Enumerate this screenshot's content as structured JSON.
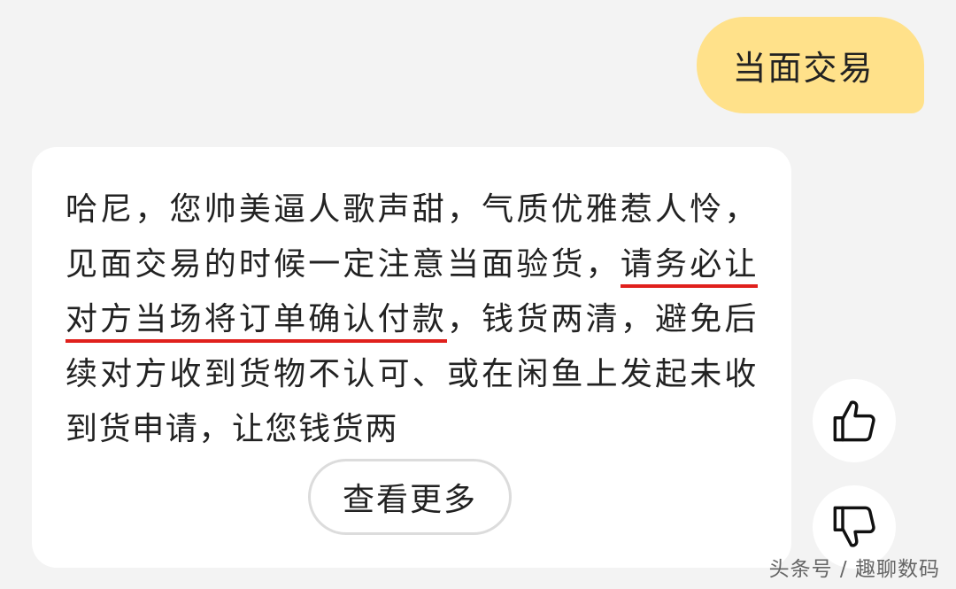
{
  "user_message": {
    "text": "当面交易"
  },
  "reply": {
    "text_before": "哈尼，您帅美逼人歌声甜，气质优雅惹人怜，见面交易的时候一定注意当面验货，",
    "text_underlined": "请务必让对方当场将订单确认付款",
    "text_after": "，钱货两清，避免后续对方收到货物不认可、或在闲鱼上发起未收到货申请，让您钱货两",
    "more_button_label": "查看更多"
  },
  "feedback": {
    "like_icon": "thumbs-up-icon",
    "dislike_icon": "thumbs-down-icon"
  },
  "watermark": {
    "text": "头条号 / 趣聊数码"
  },
  "colors": {
    "background": "#f3f3f3",
    "user_bubble": "#ffe18a",
    "card": "#ffffff",
    "underline": "#e0201c"
  }
}
